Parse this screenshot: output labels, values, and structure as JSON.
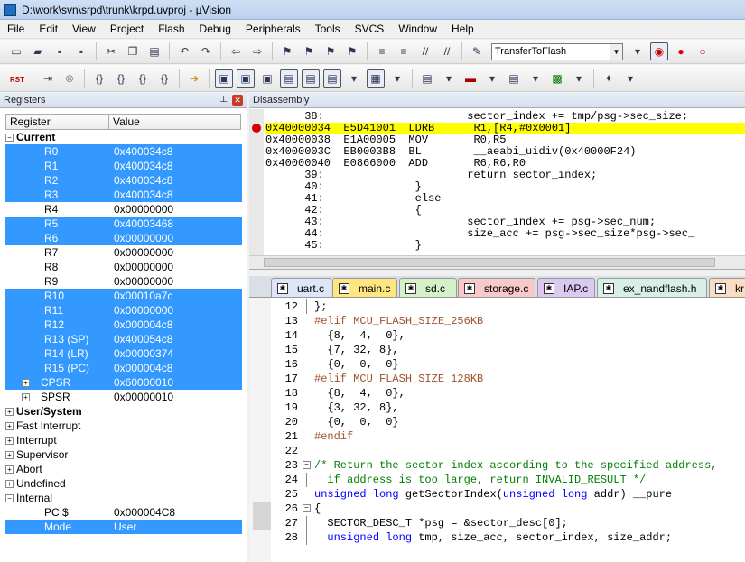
{
  "window": {
    "title": "D:\\work\\svn\\srpd\\trunk\\krpd.uvproj - µVision"
  },
  "menu": [
    "File",
    "Edit",
    "View",
    "Project",
    "Flash",
    "Debug",
    "Peripherals",
    "Tools",
    "SVCS",
    "Window",
    "Help"
  ],
  "toolbar": {
    "target": "TransferToFlash",
    "rst_label_1": "RST",
    "rst_label_2": "RST"
  },
  "registers": {
    "panel_title": "Registers",
    "col_register": "Register",
    "col_value": "Value",
    "current": "Current",
    "rows": [
      {
        "name": "R0",
        "value": "0x400034c8"
      },
      {
        "name": "R1",
        "value": "0x400034c8"
      },
      {
        "name": "R2",
        "value": "0x400034c8"
      },
      {
        "name": "R3",
        "value": "0x400034c8"
      },
      {
        "name": "R4",
        "value": "0x00000000"
      },
      {
        "name": "R5",
        "value": "0x40003468"
      },
      {
        "name": "R6",
        "value": "0x00000000"
      },
      {
        "name": "R7",
        "value": "0x00000000"
      },
      {
        "name": "R8",
        "value": "0x00000000"
      },
      {
        "name": "R9",
        "value": "0x00000000"
      },
      {
        "name": "R10",
        "value": "0x00010a7c"
      },
      {
        "name": "R11",
        "value": "0x00000000"
      },
      {
        "name": "R12",
        "value": "0x000004c8"
      },
      {
        "name": "R13 (SP)",
        "value": "0x400054c8"
      },
      {
        "name": "R14 (LR)",
        "value": "0x00000374"
      },
      {
        "name": "R15 (PC)",
        "value": "0x000004c8"
      },
      {
        "name": "CPSR",
        "value": "0x60000010"
      },
      {
        "name": "SPSR",
        "value": "0x00000010"
      }
    ],
    "groups": [
      "User/System",
      "Fast Interrupt",
      "Interrupt",
      "Supervisor",
      "Abort",
      "Undefined",
      "Internal"
    ],
    "internal_rows": [
      {
        "name": "PC  $",
        "value": "0x000004C8"
      },
      {
        "name": "Mode",
        "value": "User"
      }
    ]
  },
  "disassembly": {
    "panel_title": "Disassembly",
    "lines": [
      "      38:                      sector_index += tmp/psg->sec_size;",
      "0x40000034  E5D41001  LDRB      R1,[R4,#0x0001]",
      "0x40000038  E1A00005  MOV       R0,R5",
      "0x4000003C  EB0003B8  BL        __aeabi_uidiv(0x40000F24)",
      "0x40000040  E0866000  ADD       R6,R6,R0",
      "      39:                      return sector_index;",
      "      40:              }",
      "      41:              else",
      "      42:              {",
      "      43:                      sector_index += psg->sec_num;",
      "      44:                      size_acc += psg->sec_size*psg->sec_",
      "      45:              }"
    ]
  },
  "tabs": [
    "uart.c",
    "main.c",
    "sd.c",
    "storage.c",
    "IAP.c",
    "ex_nandflash.h",
    "kr"
  ],
  "editor": {
    "lines": [
      {
        "num": "12",
        "parts": [
          [
            "",
            "};"
          ]
        ]
      },
      {
        "num": "13",
        "parts": [
          [
            "pre",
            "#elif MCU_FLASH_SIZE_256KB"
          ]
        ]
      },
      {
        "num": "14",
        "parts": [
          [
            "",
            "  {8,  4,  0},"
          ]
        ]
      },
      {
        "num": "15",
        "parts": [
          [
            "",
            "  {7, 32, 8},"
          ]
        ]
      },
      {
        "num": "16",
        "parts": [
          [
            "",
            "  {0,  0,  0}"
          ]
        ]
      },
      {
        "num": "17",
        "parts": [
          [
            "pre",
            "#elif MCU_FLASH_SIZE_128KB"
          ]
        ]
      },
      {
        "num": "18",
        "parts": [
          [
            "",
            "  {8,  4,  0},"
          ]
        ]
      },
      {
        "num": "19",
        "parts": [
          [
            "",
            "  {3, 32, 8},"
          ]
        ]
      },
      {
        "num": "20",
        "parts": [
          [
            "",
            "  {0,  0,  0}"
          ]
        ]
      },
      {
        "num": "21",
        "parts": [
          [
            "pre",
            "#endif"
          ]
        ]
      },
      {
        "num": "22",
        "parts": [
          [
            "",
            ""
          ]
        ]
      },
      {
        "num": "23",
        "parts": [
          [
            "cm",
            "/* Return the sector index according to the specified address,"
          ]
        ]
      },
      {
        "num": "24",
        "parts": [
          [
            "cm",
            "  if address is too large, return INVALID_RESULT */"
          ]
        ]
      },
      {
        "num": "25",
        "parts": [
          [
            "kw",
            "unsigned long"
          ],
          [
            "",
            " getSectorIndex("
          ],
          [
            "kw",
            "unsigned long"
          ],
          [
            "",
            " addr) __pure"
          ]
        ]
      },
      {
        "num": "26",
        "parts": [
          [
            "",
            "{"
          ]
        ]
      },
      {
        "num": "27",
        "parts": [
          [
            "",
            "  SECTOR_DESC_T *psg = &sector_desc[0];"
          ]
        ]
      },
      {
        "num": "28",
        "parts": [
          [
            "",
            "  "
          ],
          [
            "kw",
            "unsigned long"
          ],
          [
            "",
            " tmp, size_acc, sector_index, size_addr;"
          ]
        ]
      }
    ]
  },
  "colors": {
    "selection": "#3399ff",
    "highlight": "#ffff00",
    "keyword": "#0000ff",
    "comment": "#008000",
    "preprocessor": "#a0522d"
  }
}
